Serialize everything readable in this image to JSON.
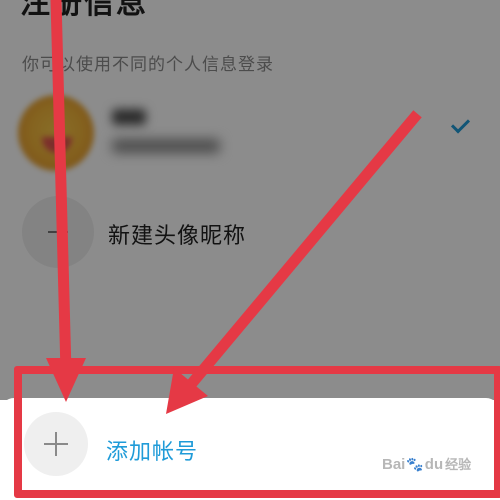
{
  "page": {
    "title": "注册信息",
    "subtitle": "你可以使用不同的个人信息登录"
  },
  "accounts": [
    {
      "selected": true
    }
  ],
  "new_profile": {
    "label": "新建头像昵称"
  },
  "bottom_sheet": {
    "add_label": "添加帐号"
  },
  "watermark": {
    "text_a": "Bai",
    "text_b": "du",
    "text_c": "经验"
  },
  "colors": {
    "accent_blue": "#1f9bd8",
    "annotation_red": "#e53945",
    "overlay": "rgba(0,0,0,0.45)"
  },
  "icons": {
    "check": "check-icon",
    "minus": "minus-icon",
    "plus": "plus-icon"
  }
}
